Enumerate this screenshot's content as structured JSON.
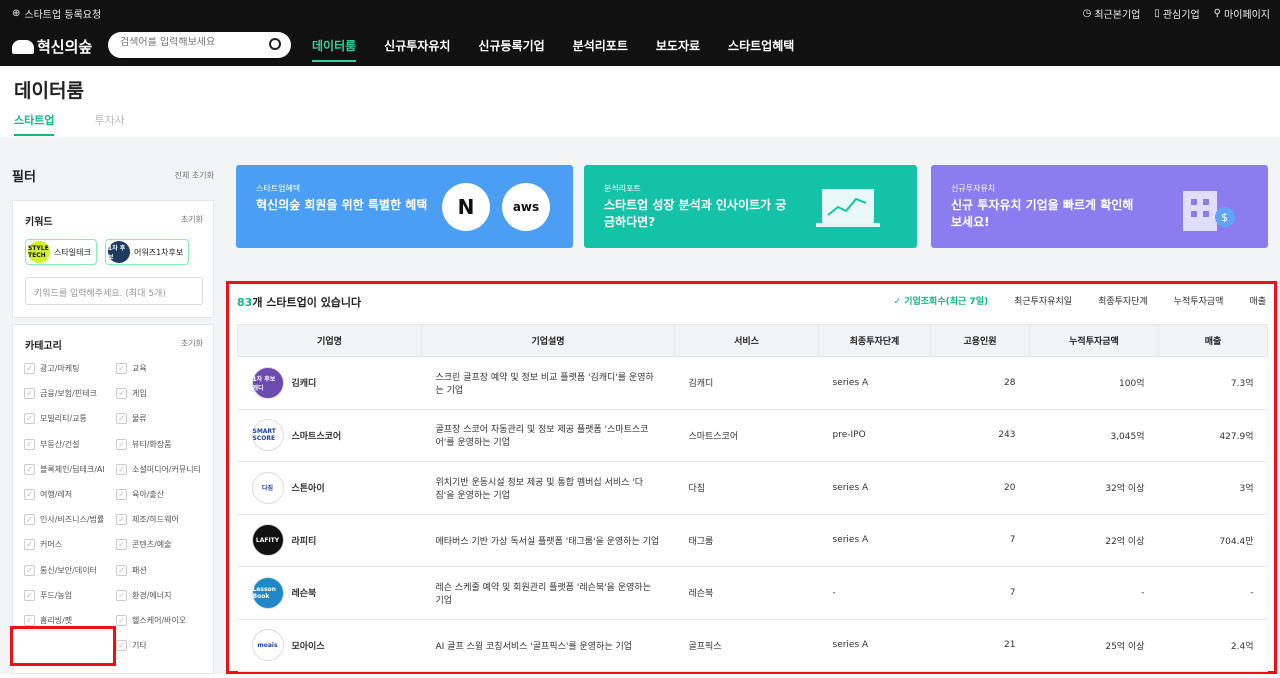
{
  "topbar": {
    "register": "스타트업 등록요청",
    "links": [
      "최근본기업",
      "관심기업",
      "마이페이지"
    ]
  },
  "nav": {
    "logo": "혁신의숲",
    "search_placeholder": "검색어를 입력해보세요",
    "menu": [
      "데이터룸",
      "신규투자유치",
      "신규등록기업",
      "분석리포트",
      "보도자료",
      "스타트업혜택"
    ]
  },
  "page": {
    "title": "데이터룸",
    "tabs": [
      "스타트업",
      "투자사"
    ]
  },
  "filter": {
    "title": "필터",
    "reset_all": "전체 초기화",
    "keyword": {
      "title": "키워드",
      "reset": "초기화",
      "chips": [
        {
          "logo": "STYLE TECH",
          "label": "스타일테크"
        },
        {
          "logo": "1차 후보",
          "label": "어워즈1차후보"
        }
      ],
      "placeholder": "키워드를 입력해주세요. (최대 5개)"
    },
    "category": {
      "title": "카테고리",
      "reset": "초기화",
      "items": [
        "광고/마케팅",
        "교육",
        "금융/보험/핀테크",
        "게임",
        "모빌리티/교통",
        "물류",
        "부동산/건설",
        "뷰티/화장품",
        "블록체인/딥테크/AI",
        "소셜미디어/커뮤니티",
        "여행/레저",
        "육아/출산",
        "인사/비즈니스/법률",
        "제조/하드웨어",
        "커머스",
        "콘텐츠/예술",
        "통신/보안/데이터",
        "패션",
        "푸드/농업",
        "환경/에너지",
        "홈리빙/펫",
        "헬스케어/바이오",
        "피트니스/스포츠",
        "기타"
      ],
      "selected": "피트니스/스포츠"
    }
  },
  "banners": [
    {
      "tag": "스타트업혜택",
      "text": "혁신의숲 회원을 위한 특별한 혜택",
      "color": "#4a9ff5",
      "logos": [
        "N",
        "aws"
      ]
    },
    {
      "tag": "분석리포트",
      "text": "스타트업 성장 분석과 인사이트가 궁금하다면?",
      "color": "#14c2a8"
    },
    {
      "tag": "신규투자유치",
      "text": "신규 투자유치 기업을 빠르게 확인해 보세요!",
      "color": "#8b7cf0"
    }
  ],
  "results": {
    "count": "83",
    "count_suffix": "개 스타트업이 있습니다",
    "sorts": [
      "✓ 기업조회수(최근 7일)",
      "최근투자유치일",
      "최종투자단계",
      "누적투자금액",
      "매출"
    ],
    "columns": [
      "기업명",
      "기업설명",
      "서비스",
      "최종투자단계",
      "고용인원",
      "누적투자금액",
      "매출"
    ],
    "rows": [
      {
        "logo": "1차 후보 캐디",
        "logo_color": "#6b4bb0",
        "name": "김캐디",
        "desc": "스크린 골프장 예약 및 정보 비교 플랫폼 '김캐디'를 운영하는 기업",
        "service": "김캐디",
        "stage": "series A",
        "employees": "28",
        "funding": "100억",
        "revenue": "7.3억"
      },
      {
        "logo": "SMART SCORE",
        "logo_color": "#fff",
        "name": "스마트스코어",
        "desc": "골프장 스코어 자동관리 및 정보 제공 플랫폼 '스마트스코어'를 운영하는 기업",
        "service": "스마트스코어",
        "stage": "pre-IPO",
        "employees": "243",
        "funding": "3,045억",
        "revenue": "427.9억"
      },
      {
        "logo": "다짐",
        "logo_color": "#fff",
        "name": "스톤아이",
        "desc": "위치기반 운동시설 정보 제공 및 통합 멤버십 서비스 '다짐'을 운영하는 기업",
        "service": "다짐",
        "stage": "series A",
        "employees": "20",
        "funding": "32억 이상",
        "revenue": "3억"
      },
      {
        "logo": "LAFITY",
        "logo_color": "#111",
        "name": "라피티",
        "desc": "메타버스 기반 가상 독서실 플랫폼 '태그룸'을 운영하는 기업",
        "service": "태그룸",
        "stage": "series A",
        "employees": "7",
        "funding": "22억 이상",
        "revenue": "704.4만"
      },
      {
        "logo": "Lesson Book",
        "logo_color": "#1e88c8",
        "name": "레슨북",
        "desc": "레슨 스케줄 예약 및 회원관리 플랫폼 '레슨북'을 운영하는 기업",
        "service": "레슨북",
        "stage": "-",
        "employees": "7",
        "funding": "-",
        "revenue": "-"
      },
      {
        "logo": "moais",
        "logo_color": "#fff",
        "name": "모아이스",
        "desc": "AI 골프 스윙 코칭서비스 '골프픽스'를 운영하는 기업",
        "service": "골프픽스",
        "stage": "series A",
        "employees": "21",
        "funding": "25억 이상",
        "revenue": "2.4억"
      }
    ]
  }
}
